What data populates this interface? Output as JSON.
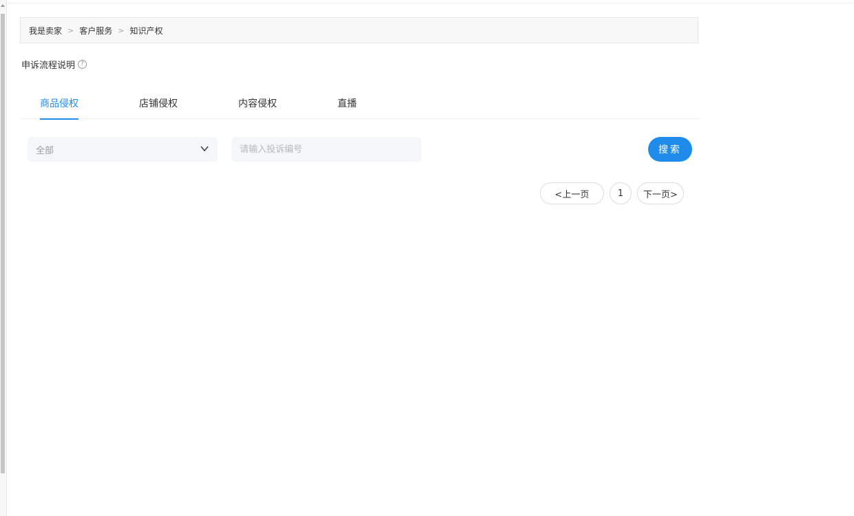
{
  "breadcrumb": {
    "items": [
      "我是卖家",
      "客户服务",
      "知识产权"
    ],
    "separator": ">"
  },
  "appeal": {
    "label": "申诉流程说明",
    "help_glyph": "?"
  },
  "tabs": [
    {
      "label": "商品侵权",
      "active": true
    },
    {
      "label": "店铺侵权",
      "active": false
    },
    {
      "label": "内容侵权",
      "active": false
    },
    {
      "label": "直播",
      "active": false
    }
  ],
  "filter": {
    "type_select_value": "全部",
    "search_placeholder": "请输入投诉编号",
    "search_button": "搜索"
  },
  "pagination": {
    "prev_label": "<上一页",
    "current_page": "1",
    "next_label": "下一页>"
  },
  "colors": {
    "accent": "#1f8ceb",
    "input_bg": "#f5f6f8",
    "breadcrumb_bg": "#f8f8f8"
  }
}
